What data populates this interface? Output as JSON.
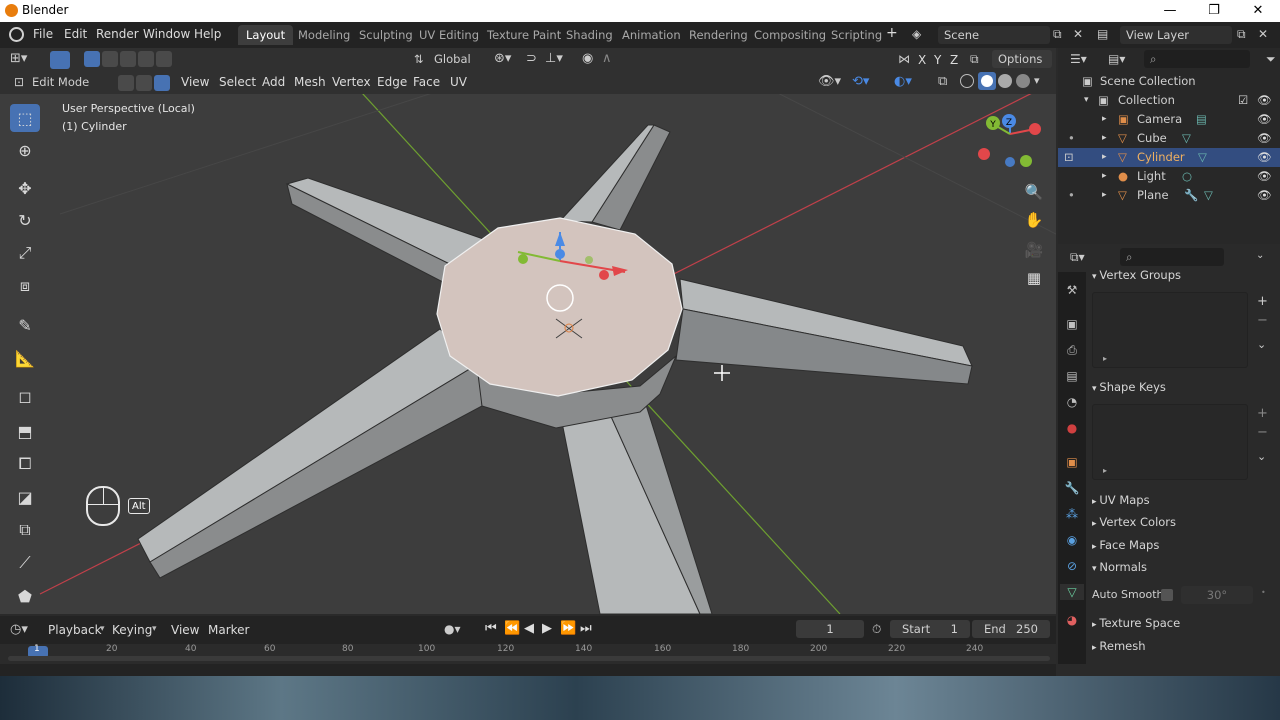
{
  "window": {
    "title": "Blender",
    "minimize_glyph": "—",
    "restore_glyph": "❐",
    "close_glyph": "✕"
  },
  "menus": [
    "File",
    "Edit",
    "Render",
    "Window",
    "Help"
  ],
  "workspaces": [
    {
      "label": "Layout",
      "active": true
    },
    {
      "label": "Modeling"
    },
    {
      "label": "Sculpting"
    },
    {
      "label": "UV Editing"
    },
    {
      "label": "Texture Paint"
    },
    {
      "label": "Shading"
    },
    {
      "label": "Animation"
    },
    {
      "label": "Rendering"
    },
    {
      "label": "Compositing"
    },
    {
      "label": "Scripting"
    }
  ],
  "add_workspace_glyph": "+",
  "scene": {
    "label": "Scene"
  },
  "view_layer": {
    "label": "View Layer"
  },
  "viewport_header": {
    "orientation": "Global",
    "axis_x": "X",
    "axis_y": "Y",
    "axis_z": "Z",
    "options": "Options",
    "mode": "Edit Mode",
    "menus": [
      "View",
      "Select",
      "Add",
      "Mesh",
      "Vertex",
      "Edge",
      "Face",
      "UV"
    ]
  },
  "viewport": {
    "view_label": "User Perspective (Local)",
    "object_label": "(1) Cylinder",
    "alt_key": "Alt",
    "nav_gizmo": {
      "y": "Y",
      "z": "Z"
    }
  },
  "outliner": {
    "root": "Scene Collection",
    "collection": "Collection",
    "items": [
      {
        "name": "Camera"
      },
      {
        "name": "Cube"
      },
      {
        "name": "Cylinder",
        "selected": true
      },
      {
        "name": "Light"
      },
      {
        "name": "Plane"
      }
    ]
  },
  "properties": {
    "vertex_groups": "Vertex Groups",
    "shape_keys": "Shape Keys",
    "uv_maps": "UV Maps",
    "vertex_colors": "Vertex Colors",
    "face_maps": "Face Maps",
    "normals": "Normals",
    "auto_smooth": "Auto Smooth",
    "auto_smooth_angle": "30°",
    "texture_space": "Texture Space",
    "remesh": "Remesh"
  },
  "timeline": {
    "menus": [
      "Playback",
      "Keying",
      "View",
      "Marker"
    ],
    "current_frame": "1",
    "start_label": "Start",
    "start_value": "1",
    "end_label": "End",
    "end_value": "250",
    "ruler": [
      "1",
      "20",
      "40",
      "60",
      "80",
      "100",
      "120",
      "140",
      "160",
      "180",
      "200",
      "220",
      "240"
    ]
  },
  "colors": {
    "accent": "#4772b3",
    "selected_row": "#334d80",
    "x_axis": "#e2474a",
    "y_axis": "#82ba34",
    "z_axis": "#4a8ae5",
    "mesh_face": "#b5b8b9",
    "selected_face": "#d3c3bd"
  }
}
